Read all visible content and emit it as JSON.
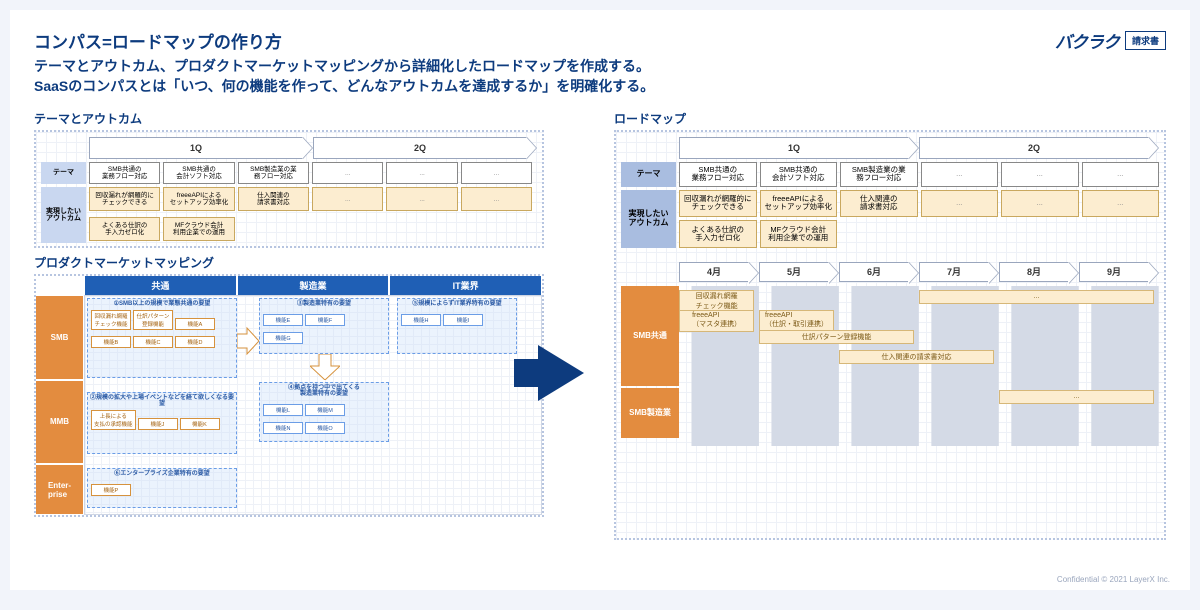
{
  "title": "コンパス=ロードマップの作り方",
  "lead1": "テーマとアウトカム、プロダクトマーケットマッピングから詳細化したロードマップを作成する。",
  "lead2": "SaaSのコンパスとは「いつ、何の機能を作って、どんなアウトカムを達成するか」を明確化する。",
  "brand": {
    "logo": "バクラク",
    "badge": "請求書"
  },
  "left": {
    "themeOutcome": {
      "title": "テーマとアウトカム",
      "quarters": [
        "1Q",
        "2Q"
      ],
      "themeLabel": "テーマ",
      "outcomeLabel": "実現したい\nアウトカム",
      "themes": [
        "SMB共通の\n業務フロー対応",
        "SMB共通の\n会計ソフト対応",
        "SMB製造業の業\n務フロー対応",
        "...",
        "...",
        "..."
      ],
      "outcomes": [
        "回収漏れが網羅的に\nチェックできる",
        "freeeAPIによる\nセットアップ効率化",
        "仕入関連の\n請求書対応",
        "...",
        "...",
        "...",
        "よくある仕訳の\n手入力ゼロ化",
        "MFクラウド会計\n利用企業での運用",
        "",
        "",
        "",
        ""
      ]
    },
    "pmm": {
      "title": "プロダクトマーケットマッピング",
      "cols": [
        "共通",
        "製造業",
        "IT業界"
      ],
      "rows": [
        "SMB",
        "MMB",
        "Enter-\nprise"
      ],
      "group1": {
        "t": "①SMB以上の規模で業態共通の要望",
        "items": [
          "回収漏れ網羅\nチェック機能",
          "仕訳パターン\n登録機能",
          "機能A",
          "機能B",
          "機能C",
          "機能D"
        ]
      },
      "group3": {
        "t": "③製造業特有の要望",
        "items": [
          "機能E",
          "機能F",
          "機能G"
        ]
      },
      "group5": {
        "t": "⑤規模によらずIT業界特有の要望",
        "items": [
          "機能H",
          "機能I"
        ]
      },
      "group2": {
        "t": "②規模の拡大や上場イベントなどを経て欲しくなる要望",
        "items": [
          "上長による\n支払の承認機能",
          "機能J",
          "機能K"
        ]
      },
      "group4": {
        "t": "④拠点を持つ中で出てくる\n製造業特有の要望",
        "items": [
          "機能L",
          "機能M",
          "機能N",
          "機能O"
        ]
      },
      "group6": {
        "t": "⑥エンタープライズ企業特有の要望",
        "items": [
          "機能P"
        ]
      }
    }
  },
  "right": {
    "title": "ロードマップ",
    "quarters": [
      "1Q",
      "2Q"
    ],
    "themeLabel": "テーマ",
    "outcomeLabel": "実現したい\nアウトカム",
    "themes": [
      "SMB共通の\n業務フロー対応",
      "SMB共通の\n会計ソフト対応",
      "SMB製造業の業\n務フロー対応",
      "...",
      "...",
      "..."
    ],
    "outcomes": [
      "回収漏れが網羅的に\nチェックできる",
      "freeeAPIによる\nセットアップ効率化",
      "仕入関連の\n請求書対応",
      "...",
      "...",
      "...",
      "よくある仕訳の\n手入力ゼロ化",
      "MFクラウド会計\n利用企業での運用",
      "",
      "",
      "",
      ""
    ],
    "months": [
      "4月",
      "5月",
      "6月",
      "7月",
      "8月",
      "9月"
    ],
    "lanes": [
      "SMB共通",
      "SMB製造業"
    ],
    "bars": [
      {
        "lane": 0,
        "row": 0,
        "start": 0,
        "span": 1,
        "label": "回収漏れ網羅\nチェック機能"
      },
      {
        "lane": 0,
        "row": 0,
        "start": 3,
        "span": 3,
        "label": "..."
      },
      {
        "lane": 0,
        "row": 1,
        "start": 0,
        "span": 1,
        "label": "freeeAPI\n（マスタ連携）"
      },
      {
        "lane": 0,
        "row": 1,
        "start": 1,
        "span": 1,
        "label": "freeeAPI\n（仕訳・取引連携）"
      },
      {
        "lane": 0,
        "row": 2,
        "start": 1,
        "span": 2,
        "label": "仕訳パターン登録機能"
      },
      {
        "lane": 0,
        "row": 3,
        "start": 2,
        "span": 2,
        "label": "仕入関連の請求書対応"
      },
      {
        "lane": 1,
        "row": 0,
        "start": 4,
        "span": 2,
        "label": "..."
      }
    ]
  },
  "footer": "Confidential  © 2021 LayerX Inc."
}
